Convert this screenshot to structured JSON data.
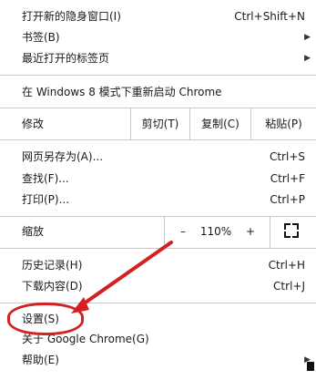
{
  "menu": {
    "incognito": {
      "label": "打开新的隐身窗口(I)",
      "shortcut": "Ctrl+Shift+N"
    },
    "bookmarks": {
      "label": "书签(B)"
    },
    "recent_tabs": {
      "label": "最近打开的标签页"
    },
    "relaunch": {
      "label": "在 Windows 8 模式下重新启动 Chrome"
    },
    "edit": {
      "label": "修改",
      "cut": "剪切(T)",
      "copy": "复制(C)",
      "paste": "粘贴(P)"
    },
    "save_as": {
      "label": "网页另存为(A)...",
      "shortcut": "Ctrl+S"
    },
    "find": {
      "label": "查找(F)...",
      "shortcut": "Ctrl+F"
    },
    "print": {
      "label": "打印(P)...",
      "shortcut": "Ctrl+P"
    },
    "zoom": {
      "label": "缩放",
      "minus": "–",
      "value": "110%",
      "plus": "+"
    },
    "history": {
      "label": "历史记录(H)",
      "shortcut": "Ctrl+H"
    },
    "downloads": {
      "label": "下载内容(D)",
      "shortcut": "Ctrl+J"
    },
    "settings": {
      "label": "设置(S)"
    },
    "about": {
      "label": "关于 Google Chrome(G)"
    },
    "help": {
      "label": "帮助(E)"
    }
  },
  "annotation": {
    "color": "#d42020"
  }
}
